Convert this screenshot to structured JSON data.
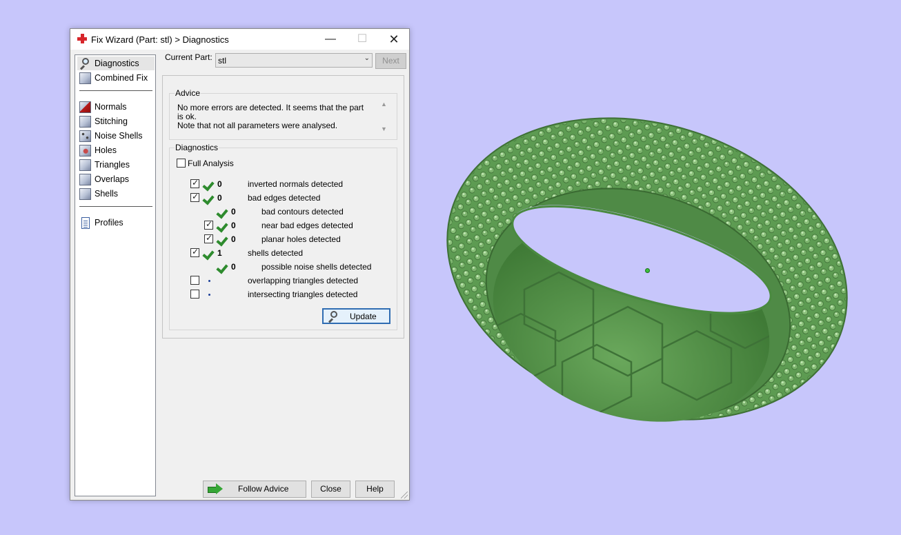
{
  "window": {
    "title": "Fix Wizard (Part: stl) > Diagnostics",
    "controls": {
      "minimize": "—",
      "maximize": "☐",
      "close": "✕"
    }
  },
  "sidebar": {
    "items": [
      {
        "label": "Diagnostics",
        "icon": "magnifier-icon"
      },
      {
        "label": "Combined Fix",
        "icon": "cube-icon"
      },
      {
        "label": "Normals",
        "icon": "normals-cube-icon"
      },
      {
        "label": "Stitching",
        "icon": "stitching-cube-icon"
      },
      {
        "label": "Noise Shells",
        "icon": "noise-shells-icon"
      },
      {
        "label": "Holes",
        "icon": "holes-cube-icon"
      },
      {
        "label": "Triangles",
        "icon": "triangles-cube-icon"
      },
      {
        "label": "Overlaps",
        "icon": "overlaps-cube-icon"
      },
      {
        "label": "Shells",
        "icon": "shells-cube-icon"
      },
      {
        "label": "Profiles",
        "icon": "document-icon"
      }
    ]
  },
  "current_part": {
    "label": "Current Part:",
    "value": "stl",
    "next_label": "Next"
  },
  "advice": {
    "title": "Advice",
    "text_line1": "No more errors are detected. It seems that the part is ok.",
    "text_line2": "Note that not all parameters were analysed."
  },
  "diagnostics": {
    "title": "Diagnostics",
    "full_analysis_label": "Full Analysis",
    "rows": [
      {
        "count": "0",
        "label": "inverted normals detected"
      },
      {
        "count": "0",
        "label": "bad edges detected"
      },
      {
        "count": "0",
        "label": "bad contours detected"
      },
      {
        "count": "0",
        "label": "near bad edges detected"
      },
      {
        "count": "0",
        "label": "planar holes detected"
      },
      {
        "count": "1",
        "label": "shells detected"
      },
      {
        "count": "0",
        "label": "possible noise shells detected"
      },
      {
        "count": "",
        "label": "overlapping triangles detected"
      },
      {
        "count": "",
        "label": "intersecting triangles detected"
      }
    ],
    "update_label": "Update"
  },
  "footer": {
    "follow_advice_label": "Follow Advice",
    "close_label": "Close",
    "help_label": "Help"
  },
  "colors": {
    "background": "#c7c6fb",
    "model_green": "#5f9e54",
    "check_green": "#2e8b2e",
    "brand_red": "#d7262b"
  }
}
